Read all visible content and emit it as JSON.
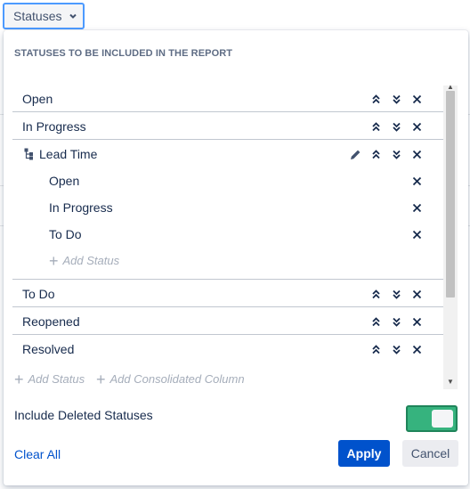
{
  "trigger": {
    "label": "Statuses",
    "icon": "chevron-down-icon"
  },
  "panel": {
    "heading": "STATUSES TO BE INCLUDED IN THE REPORT",
    "statuses": [
      {
        "label": "Open"
      },
      {
        "label": "In Progress"
      },
      {
        "label": "Lead Time",
        "type": "consolidated",
        "icon": "hierarchy-icon",
        "children": [
          "Open",
          "In Progress",
          "To Do"
        ],
        "add_child_label": "Add Status"
      },
      {
        "label": "To Do"
      },
      {
        "label": "Reopened"
      },
      {
        "label": "Resolved"
      }
    ],
    "add_status_label": "Add Status",
    "add_consolidated_label": "Add Consolidated Column",
    "include_deleted_label": "Include Deleted Statuses",
    "include_deleted_on": true,
    "clear_all_label": "Clear All",
    "apply_label": "Apply",
    "cancel_label": "Cancel"
  },
  "colors": {
    "primary": "#0052cc",
    "toggle_on": "#36b37e",
    "text": "#172b4d",
    "muted": "#a5adba"
  }
}
